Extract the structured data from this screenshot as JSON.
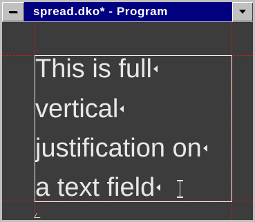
{
  "window": {
    "title": "spread.dko* - Program",
    "colors": {
      "titlebar": "#000080",
      "chrome": "#c0c0c0",
      "canvas": "#3c3c3c",
      "guides": "#cc1a1a",
      "text": "#e8e8e8"
    }
  },
  "icons": {
    "system_menu": "system-menu-icon",
    "dropdown": "chevron-down-icon",
    "paragraph_mark": "paragraph-mark-icon",
    "text_cursor": "ibeam-cursor-icon"
  },
  "text_field": {
    "lines": [
      "This is full",
      "vertical",
      "justification on",
      "a text field"
    ]
  }
}
